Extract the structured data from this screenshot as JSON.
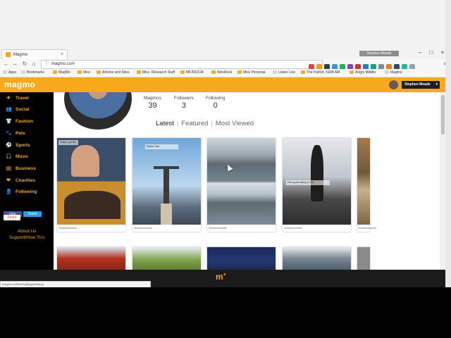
{
  "browser": {
    "tab_title": "Magmo",
    "tab_close": "×",
    "profile_chip": "Stephen Meade",
    "url": "magmo.co/#",
    "window_buttons": [
      "–",
      "□",
      "×"
    ],
    "nav": {
      "back": "←",
      "forward": "→",
      "reload": "↻",
      "home": "⌂"
    },
    "bookmarks": [
      "Apps",
      "Bookmarks",
      "MagMo",
      "Misc",
      "Articles and Sites",
      "Misc. Research Stuff",
      "MF/RS/CM",
      "WesRock",
      "Misc Personal",
      "Listen Live",
      "The Patriot, KEIB AM",
      "Angry Middle",
      "Magmo"
    ],
    "status_url": "magmo.co/#!tuhGpMagmoDialog"
  },
  "header": {
    "logo": "magmo",
    "user_name": "Stephen Meade",
    "caret": "▾"
  },
  "sidebar": {
    "items": [
      {
        "label": "Travel",
        "icon": "airplane-icon",
        "glyph": "✈"
      },
      {
        "label": "Social",
        "icon": "people-icon",
        "glyph": "👥"
      },
      {
        "label": "Fashion",
        "icon": "shirt-icon",
        "glyph": "👕"
      },
      {
        "label": "Pets",
        "icon": "paw-icon",
        "glyph": "🐾"
      },
      {
        "label": "Sports",
        "icon": "ball-icon",
        "glyph": "⚽"
      },
      {
        "label": "Music",
        "icon": "headphones-icon",
        "glyph": "🎧"
      },
      {
        "label": "Business",
        "icon": "briefcase-icon",
        "glyph": "💼"
      },
      {
        "label": "Charities",
        "icon": "heart-icon",
        "glyph": "❤"
      },
      {
        "label": "Following",
        "icon": "person-icon",
        "glyph": "👤"
      }
    ],
    "fb_like": "Like",
    "tweet": "Tweet",
    "gplus_share": "Share",
    "about": "About Us",
    "support": "Support/How To's"
  },
  "profile": {
    "stats": [
      {
        "label": "Magmos",
        "value": "39"
      },
      {
        "label": "Followers",
        "value": "3"
      },
      {
        "label": "Following",
        "value": "0"
      }
    ]
  },
  "tabs": [
    "Latest",
    "Featured",
    "Most Viewed"
  ],
  "cards": [
    {
      "owner": "Stephenmeade",
      "tag": "Today I got the"
    },
    {
      "owner": "Stephenmeade",
      "tag": "Statue Oslo"
    },
    {
      "owner": "Stephenmeade",
      "tag": ""
    },
    {
      "owner": "Stephenmeade",
      "tag": "Here goes skiing to Oslo"
    },
    {
      "owner": "Stephenmeade",
      "tag": ""
    }
  ],
  "bottom_logo": "m",
  "bottom_logo_sup": "+",
  "colors": {
    "accent": "#f7a81b",
    "sidebar_bg": "#000000"
  }
}
